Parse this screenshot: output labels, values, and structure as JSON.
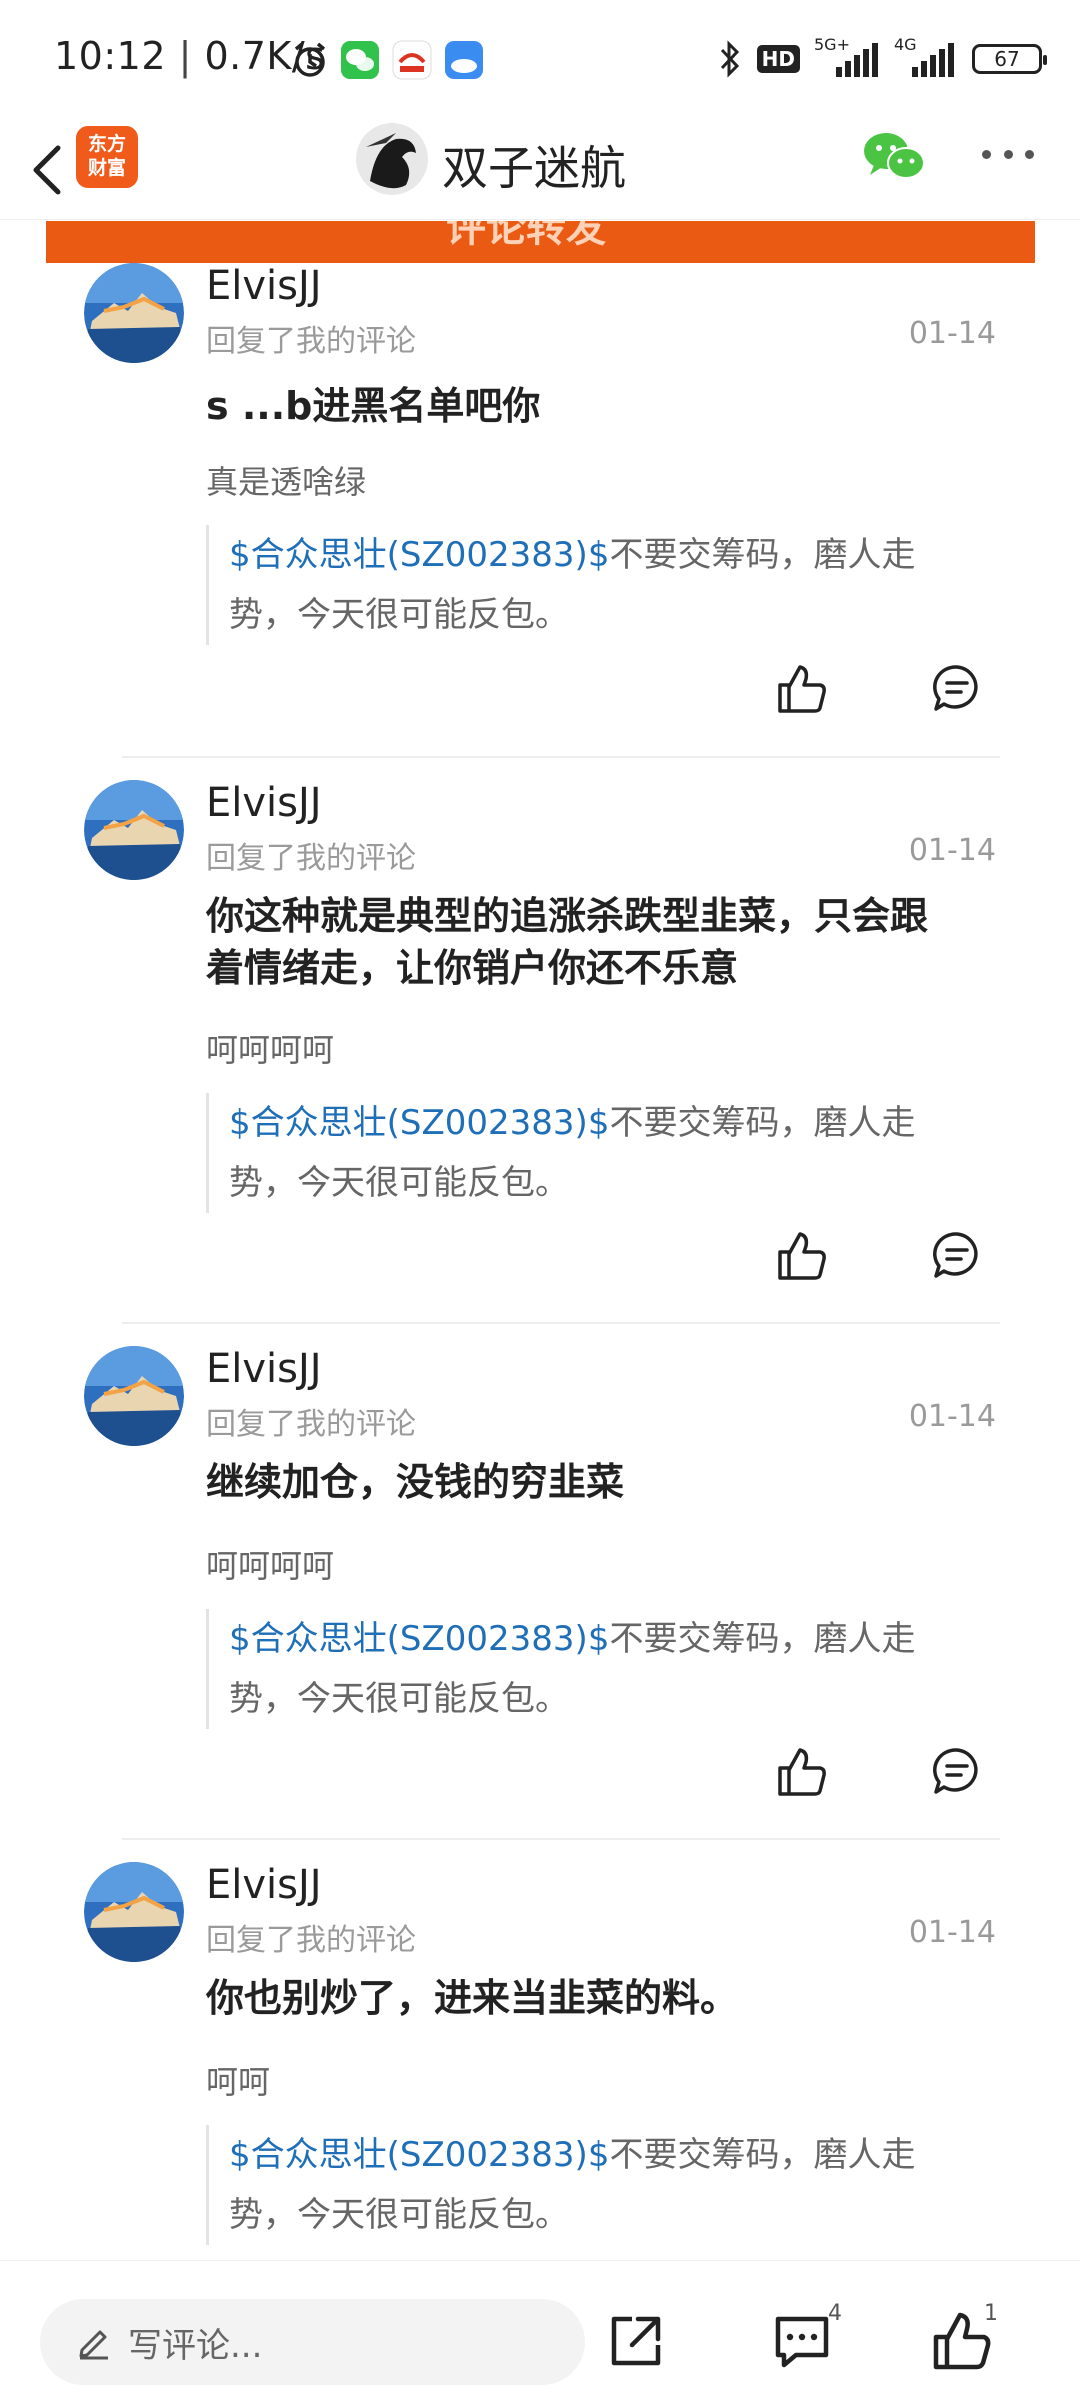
{
  "status_bar": {
    "time": "10:12",
    "speed": "0.7K/s",
    "battery": "67",
    "network_5g": "5G+",
    "network_4g": "4G",
    "hd_badge": "HD"
  },
  "header": {
    "app_logo_line1": "东方",
    "app_logo_line2": "财富",
    "title": "双子迷航",
    "banner_text": "评论转发"
  },
  "comments": [
    {
      "username": "ElvisJJ",
      "action": "回复了我的评论",
      "date": "01-14",
      "text": "s  ...b进黑名单吧你",
      "sub": "真是透啥绿",
      "quote_stock": "$合众思壮(SZ002383)$",
      "quote_line1": "不要交筹码，磨人走",
      "quote_line2": "势，今天很可能反包。"
    },
    {
      "username": "ElvisJJ",
      "action": "回复了我的评论",
      "date": "01-14",
      "text_line1": "你这种就是典型的追涨杀跌型韭菜，只会跟",
      "text_line2": "着情绪走，让你销户你还不乐意",
      "sub": "呵呵呵呵",
      "quote_stock": "$合众思壮(SZ002383)$",
      "quote_line1": "不要交筹码，磨人走",
      "quote_line2": "势，今天很可能反包。"
    },
    {
      "username": "ElvisJJ",
      "action": "回复了我的评论",
      "date": "01-14",
      "text": "继续加仓，没钱的穷韭菜",
      "sub": "呵呵呵呵",
      "quote_stock": "$合众思壮(SZ002383)$",
      "quote_line1": "不要交筹码，磨人走",
      "quote_line2": "势，今天很可能反包。"
    },
    {
      "username": "ElvisJJ",
      "action": "回复了我的评论",
      "date": "01-14",
      "text": "你也别炒了，进来当韭菜的料。",
      "sub": "呵呵",
      "quote_stock": "$合众思壮(SZ002383)$",
      "quote_line1": "不要交筹码，磨人走",
      "quote_line2": "势，今天很可能反包。"
    }
  ],
  "bottom_bar": {
    "input_placeholder": "写评论...",
    "comment_count": "4",
    "like_count": "1"
  },
  "colors": {
    "brand_orange": "#eb5a12",
    "stock_link": "#1f6fb8",
    "wechat_green": "#4cc443"
  },
  "icons": [
    "back-icon",
    "alarm-icon",
    "wechat-icon",
    "bluetooth-icon",
    "signal-icon",
    "battery-icon",
    "like-icon",
    "reply-icon",
    "pencil-icon",
    "share-icon",
    "comment-icon",
    "more-icon"
  ]
}
